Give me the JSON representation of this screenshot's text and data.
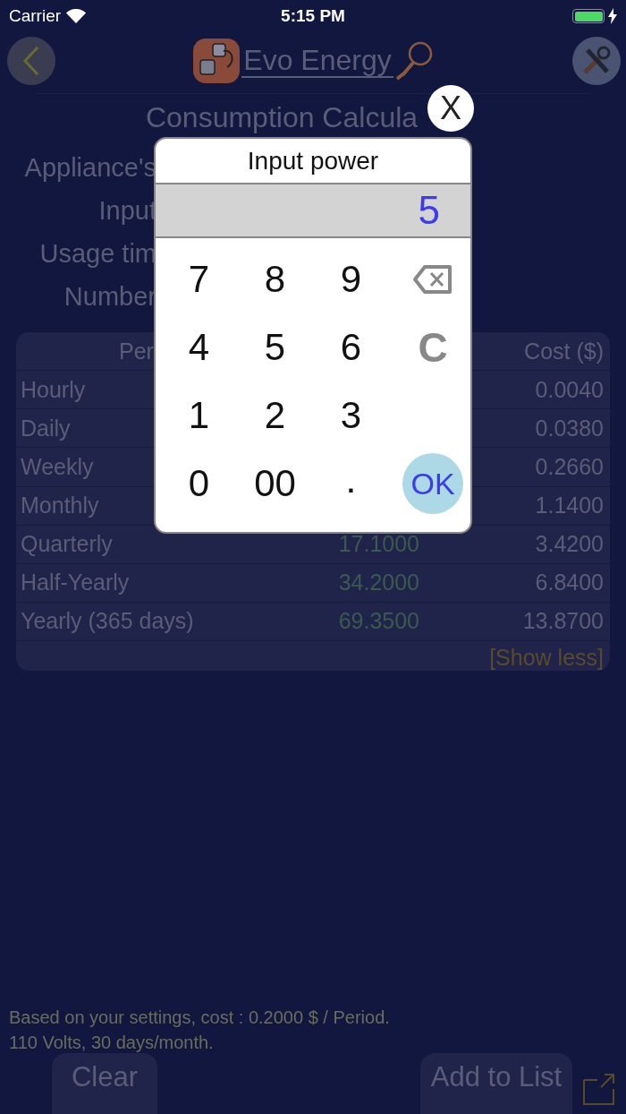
{
  "status_bar": {
    "carrier": "Carrier",
    "time": "5:15 PM",
    "charging": true
  },
  "header": {
    "logo_text": "Evo Energy"
  },
  "title": "Consumption Calcula",
  "form_labels": [
    "Appliance's",
    "Input",
    "Usage tim",
    "Number"
  ],
  "table": {
    "columns": [
      "Per",
      "Cost ($)"
    ],
    "rows": [
      {
        "period": "Hourly",
        "cost": "0.0040"
      },
      {
        "period": "Daily",
        "cost": "0.0380"
      },
      {
        "period": "Weekly",
        "cost": "0.2660"
      },
      {
        "period": "Monthly",
        "cost": "1.1400"
      },
      {
        "period": "Quarterly",
        "column_2": "17.1000",
        "cost": "3.4200"
      },
      {
        "period": "Half-Yearly",
        "column_2": "34.2000",
        "cost": "6.8400"
      },
      {
        "period": "Yearly (365 days)",
        "column_2": "69.3500",
        "cost": "13.8700"
      }
    ],
    "toggle_link": "[Show less]"
  },
  "note": [
    "Based on your settings, cost : 0.2000 $ / Period.",
    "110 Volts, 30 days/month."
  ],
  "buttons": {
    "clear": "Clear",
    "add": "Add to List"
  },
  "dialog": {
    "title": "Input power",
    "value": "5",
    "close": "X",
    "keypad": [
      [
        {
          "kind": "digit",
          "label": "7"
        },
        {
          "kind": "digit",
          "label": "8"
        },
        {
          "kind": "digit",
          "label": "9"
        },
        {
          "kind": "backspace"
        }
      ],
      [
        {
          "kind": "digit",
          "label": "4"
        },
        {
          "kind": "digit",
          "label": "5"
        },
        {
          "kind": "digit",
          "label": "6"
        },
        {
          "kind": "clear",
          "label": "C"
        }
      ],
      [
        {
          "kind": "digit",
          "label": "1"
        },
        {
          "kind": "digit",
          "label": "2"
        },
        {
          "kind": "digit",
          "label": "3"
        }
      ],
      [
        {
          "kind": "digit",
          "label": "0"
        },
        {
          "kind": "digit",
          "label": "00"
        },
        {
          "kind": "dot",
          "label": "."
        },
        {
          "kind": "ok",
          "label": "OK"
        }
      ]
    ]
  }
}
